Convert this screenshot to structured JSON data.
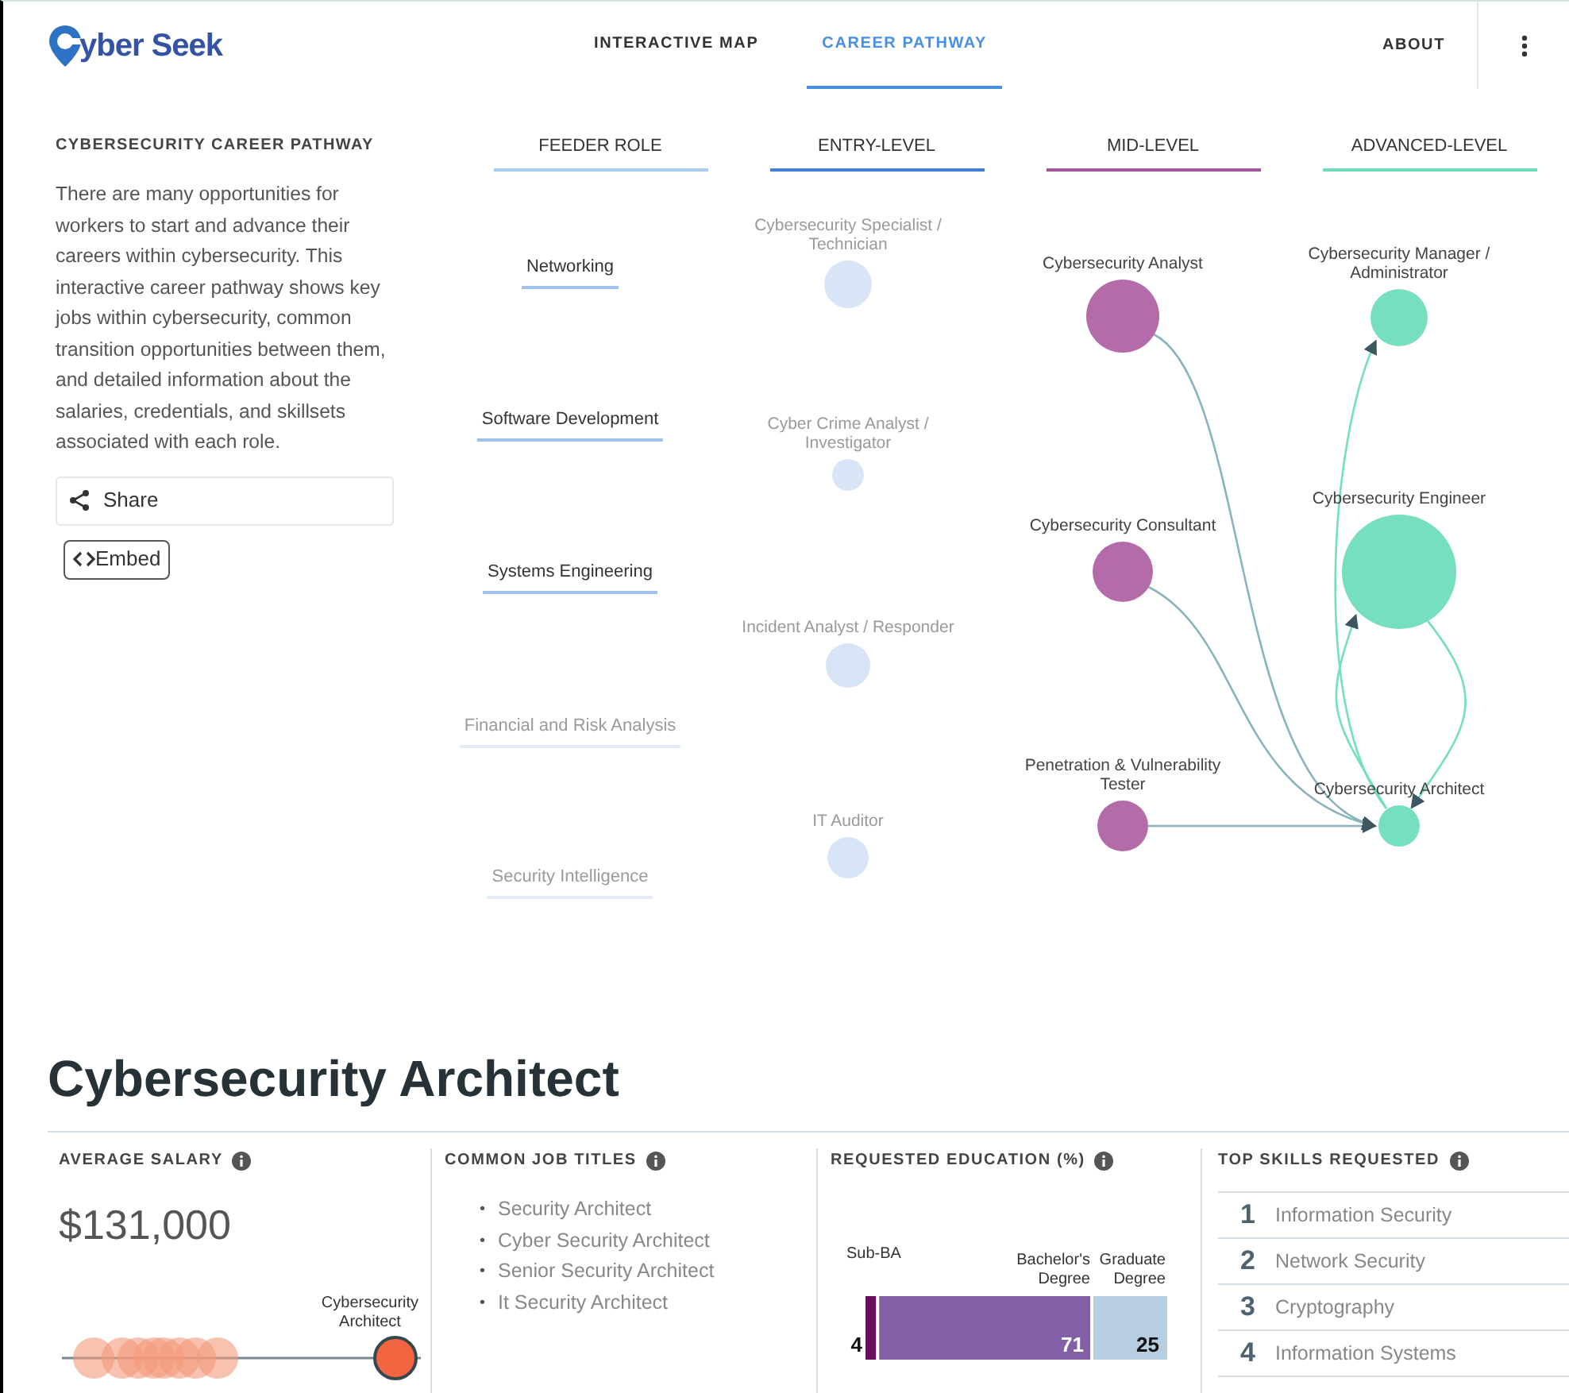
{
  "header": {
    "logo": "yber Seek",
    "tabs": [
      {
        "label": "INTERACTIVE MAP",
        "selected": false
      },
      {
        "label": "CAREER PATHWAY",
        "selected": true
      }
    ],
    "about": "ABOUT"
  },
  "sidebar": {
    "title": "CYBERSECURITY CAREER PATHWAY",
    "description": "There are many opportunities for workers to start and advance their careers within cybersecurity. This interactive career pathway shows key jobs within cybersecurity, common transition opportunities between them, and detailed information about the salaries, credentials, and skillsets associated with each role.",
    "share": "Share",
    "embed": "Embed"
  },
  "pathway": {
    "columns": [
      {
        "label": "FEEDER ROLE",
        "color": "#a9cff0"
      },
      {
        "label": "ENTRY-LEVEL",
        "color": "#3f80d9"
      },
      {
        "label": "MID-LEVEL",
        "color": "#a4579c"
      },
      {
        "label": "ADVANCED-LEVEL",
        "color": "#6fdcb7"
      }
    ],
    "feeder_roles": [
      {
        "label": "Networking",
        "active": true
      },
      {
        "label": "Software Development",
        "active": true
      },
      {
        "label": "Systems Engineering",
        "active": true
      },
      {
        "label": "Financial and Risk Analysis",
        "active": false
      },
      {
        "label": "Security Intelligence",
        "active": false
      }
    ],
    "entry_level": [
      {
        "label": "Cybersecurity Specialist / Technician",
        "active": false
      },
      {
        "label": "Cyber Crime Analyst / Investigator",
        "active": false
      },
      {
        "label": "Incident Analyst / Responder",
        "active": false
      },
      {
        "label": "IT Auditor",
        "active": false
      }
    ],
    "mid_level": [
      {
        "label": "Cybersecurity Analyst",
        "active": true
      },
      {
        "label": "Cybersecurity Consultant",
        "active": true
      },
      {
        "label": "Penetration & Vulnerability Tester",
        "active": true
      }
    ],
    "advanced_level": [
      {
        "label": "Cybersecurity Manager / Administrator",
        "active": true
      },
      {
        "label": "Cybersecurity Engineer",
        "active": true
      },
      {
        "label": "Cybersecurity Architect",
        "active": true
      }
    ]
  },
  "role_title": "Cybersecurity Architect",
  "salary": {
    "heading": "AVERAGE SALARY",
    "value": "$131,000",
    "highlight_label": "Cybersecurity Architect"
  },
  "job_titles": {
    "heading": "COMMON JOB TITLES",
    "items": [
      {
        "marker": "•",
        "label": "Security Architect"
      },
      {
        "marker": "•",
        "label": "Cyber Security Architect"
      },
      {
        "marker": "•",
        "label": "Senior Security Architect"
      },
      {
        "marker": "•",
        "label": "It Security Architect"
      }
    ]
  },
  "education": {
    "heading": "REQUESTED EDUCATION (%)",
    "chart_data": {
      "type": "bar",
      "orientation": "horizontal",
      "stacked": true,
      "data_labels": true,
      "series": [
        {
          "name": "Sub-BA",
          "color": "#6a0f5f",
          "values": [
            4
          ]
        },
        {
          "name": "Bachelor's Degree",
          "color": "#8360a6",
          "values": [
            71
          ]
        },
        {
          "name": "Graduate Degree",
          "color": "#b7cde2",
          "values": [
            25
          ]
        }
      ]
    }
  },
  "skills": {
    "heading": "TOP SKILLS REQUESTED",
    "items": [
      {
        "rank": "1",
        "label": "Information Security"
      },
      {
        "rank": "2",
        "label": "Network Security"
      },
      {
        "rank": "3",
        "label": "Cryptography"
      },
      {
        "rank": "4",
        "label": "Information Systems"
      }
    ]
  }
}
